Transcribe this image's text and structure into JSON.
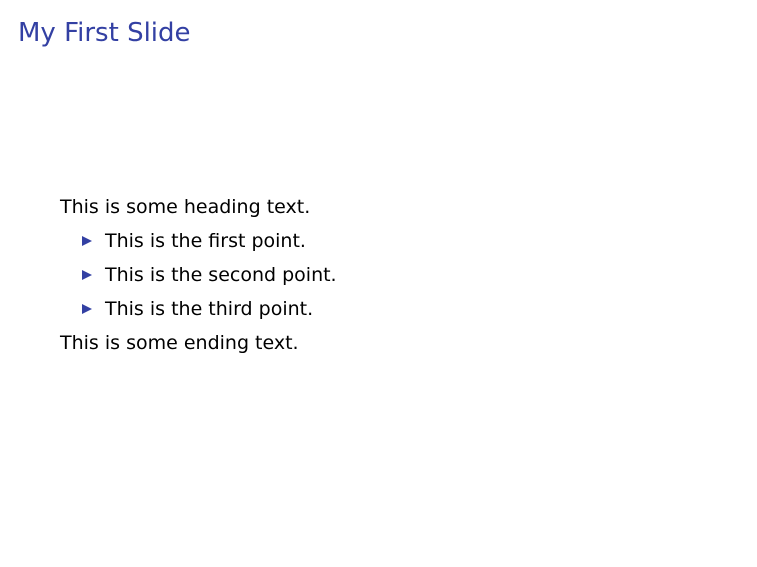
{
  "slide": {
    "title": "My First Slide",
    "heading_text": "This is some heading text.",
    "items": [
      {
        "label": "This is the first point."
      },
      {
        "label": "This is the second point."
      },
      {
        "label": "This is the third point."
      }
    ],
    "ending_text": "This is some ending text."
  },
  "colors": {
    "title": "#3340a3",
    "bullet": "#3340a3",
    "text": "#000000",
    "background": "#ffffff"
  },
  "icons": {
    "bullet": "triangle-right-icon"
  }
}
